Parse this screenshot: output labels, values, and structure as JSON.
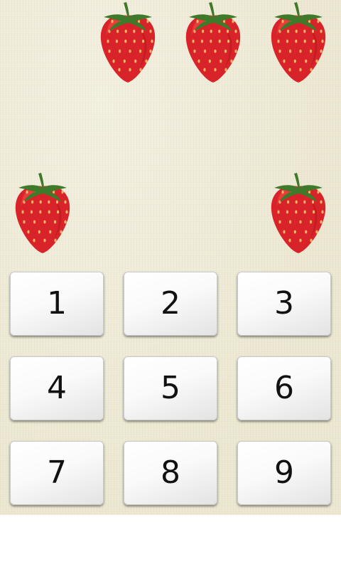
{
  "colors": {
    "board_background": "#eeead6",
    "below_board": "#ffffff",
    "key_face": "#f7f7f7",
    "key_text": "#111111",
    "strawberry_body": "#d9232a",
    "strawberry_leaves": "#3f7a2a"
  },
  "fruit_icon": "strawberry-icon",
  "fruit_slots": [
    true,
    true,
    true,
    false,
    false,
    false,
    true,
    false,
    true
  ],
  "fruit_count": 5,
  "keypad": {
    "keys": [
      "1",
      "2",
      "3",
      "4",
      "5",
      "6",
      "7",
      "8",
      "9"
    ]
  }
}
